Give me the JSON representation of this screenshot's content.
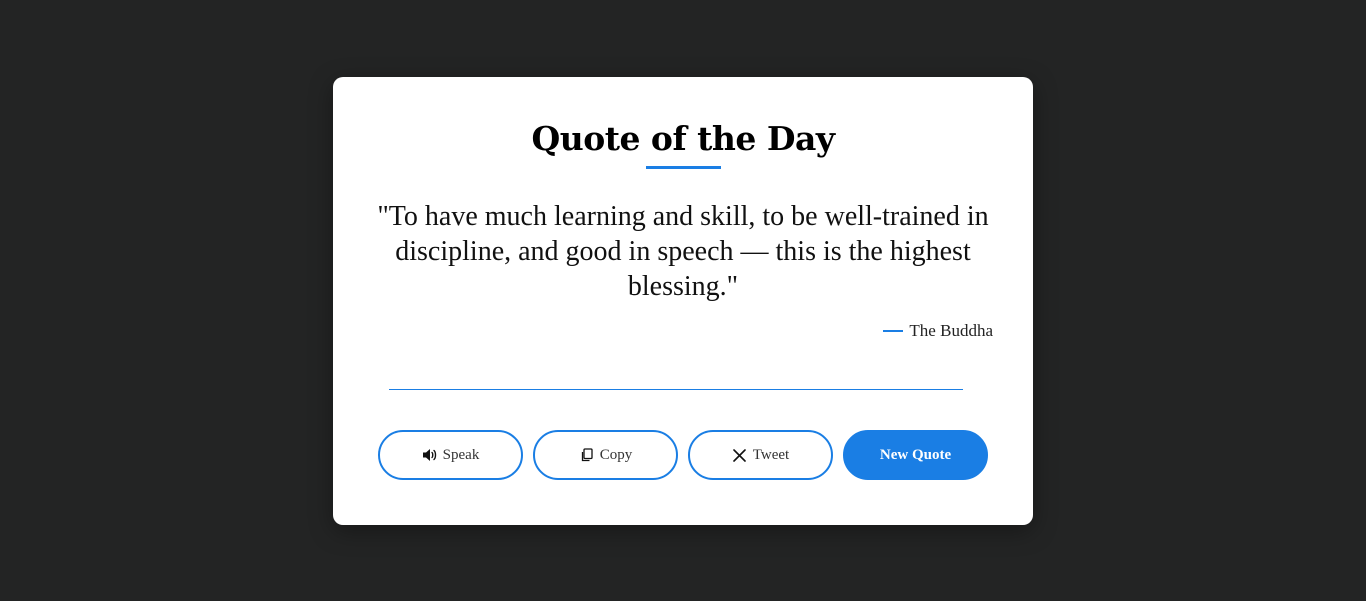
{
  "card": {
    "title": "Quote of the Day",
    "quote": "\"To have much learning and skill, to be well-trained in discipline, and good in speech — this is the highest blessing.\"",
    "author": "The Buddha"
  },
  "buttons": {
    "speak": {
      "label": "Speak",
      "icon": "speaker-icon"
    },
    "copy": {
      "label": "Copy",
      "icon": "copy-icon"
    },
    "tweet": {
      "label": "Tweet",
      "icon": "x-logo-icon"
    },
    "new_quote": {
      "label": "New Quote"
    }
  },
  "colors": {
    "background": "#232424",
    "card": "#ffffff",
    "accent": "#1a7ee4"
  }
}
